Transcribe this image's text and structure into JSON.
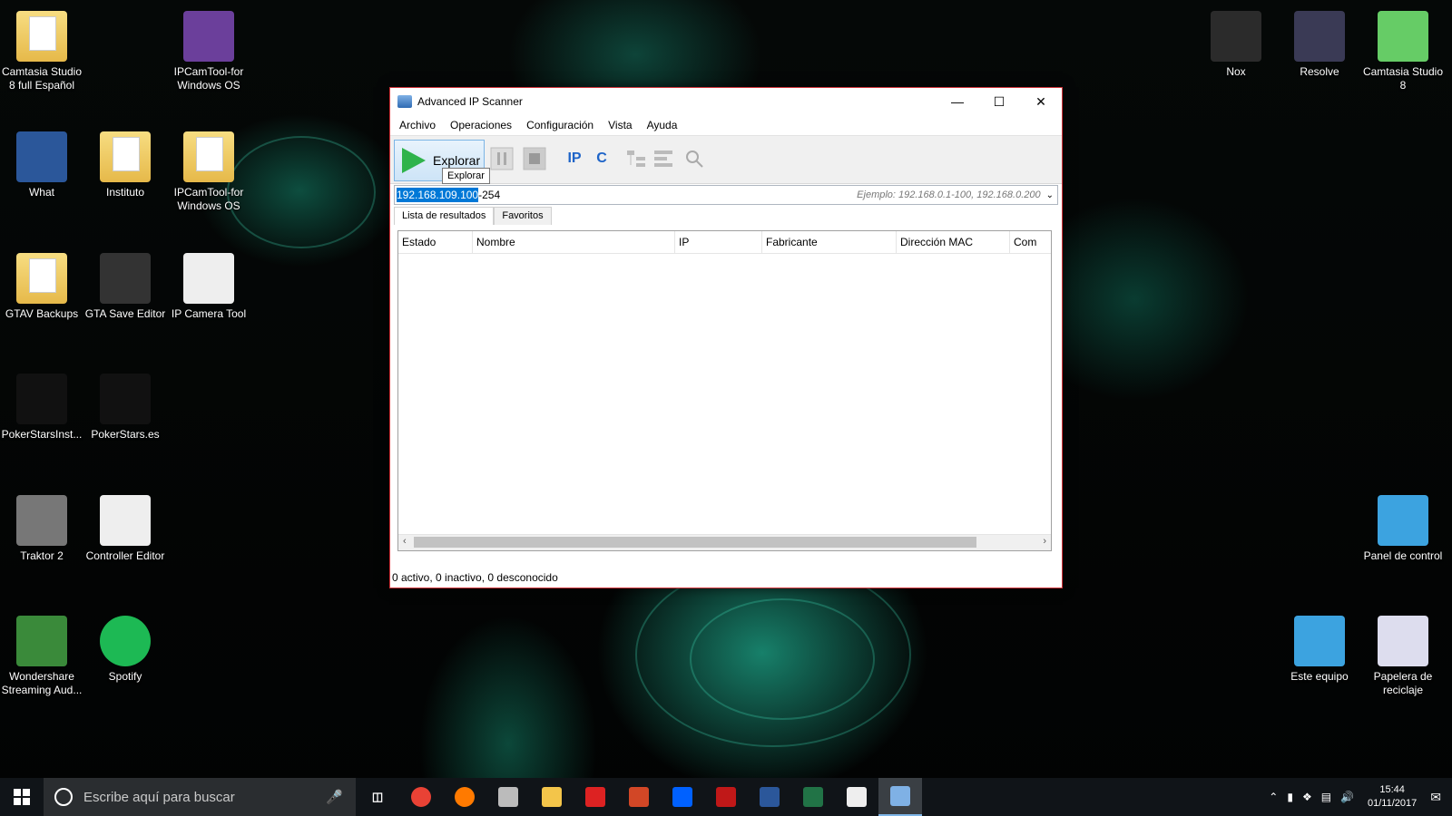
{
  "desktop": {
    "left_icons": [
      {
        "label": "Camtasia Studio 8 full Español",
        "icon": "folder-icon"
      },
      {
        "label": "IPCamTool-for Windows OS",
        "icon": "winrar-icon"
      },
      {
        "label": "What",
        "icon": "word-doc-icon"
      },
      {
        "label": "Instituto",
        "icon": "folder-icon"
      },
      {
        "label": "IPCamTool-for Windows OS",
        "icon": "folder-icon"
      },
      {
        "label": "GTAV Backups",
        "icon": "folder-icon"
      },
      {
        "label": "GTA Save Editor",
        "icon": "gta-icon"
      },
      {
        "label": "IP Camera Tool",
        "icon": "camera-icon"
      },
      {
        "label": "PokerStarsInst...",
        "icon": "pokerstars-installer-icon"
      },
      {
        "label": "PokerStars.es",
        "icon": "pokerstars-icon"
      },
      {
        "label": "Traktor 2",
        "icon": "traktor-icon"
      },
      {
        "label": "Controller Editor",
        "icon": "controller-editor-icon"
      },
      {
        "label": "Wondershare Streaming Aud...",
        "icon": "wondershare-icon"
      },
      {
        "label": "Spotify",
        "icon": "spotify-icon"
      }
    ],
    "right_icons": [
      {
        "label": "Nox",
        "icon": "nox-icon"
      },
      {
        "label": "Resolve",
        "icon": "resolve-icon"
      },
      {
        "label": "Camtasia Studio 8",
        "icon": "camtasia-icon"
      },
      {
        "label": "Panel de control",
        "icon": "control-panel-icon"
      },
      {
        "label": "Este equipo",
        "icon": "computer-icon"
      },
      {
        "label": "Papelera de reciclaje",
        "icon": "recycle-bin-icon"
      }
    ]
  },
  "window": {
    "title": "Advanced IP Scanner",
    "menu": [
      "Archivo",
      "Operaciones",
      "Configuración",
      "Vista",
      "Ayuda"
    ],
    "scan_button": "Explorar",
    "tooltip": "Explorar",
    "ip_button": "IP",
    "c_button": "C",
    "address": {
      "selected": "192.168.109.100",
      "rest": "-254",
      "hint": "Ejemplo: 192.168.0.1-100, 192.168.0.200"
    },
    "tabs": [
      "Lista de resultados",
      "Favoritos"
    ],
    "columns": [
      "Estado",
      "Nombre",
      "IP",
      "Fabricante",
      "Dirección MAC",
      "Com"
    ],
    "status": "0 activo, 0 inactivo, 0 desconocido"
  },
  "taskbar": {
    "search_placeholder": "Escribe aquí para buscar",
    "apps": [
      "chrome-icon",
      "firefox-icon",
      "app-icon",
      "explorer-icon",
      "pokerstars-icon",
      "powerpoint-icon",
      "dropbox-icon",
      "mcafee-icon",
      "word-icon",
      "excel-icon",
      "mail-icon",
      "ip-scanner-icon"
    ],
    "time": "15:44",
    "date": "01/11/2017"
  }
}
